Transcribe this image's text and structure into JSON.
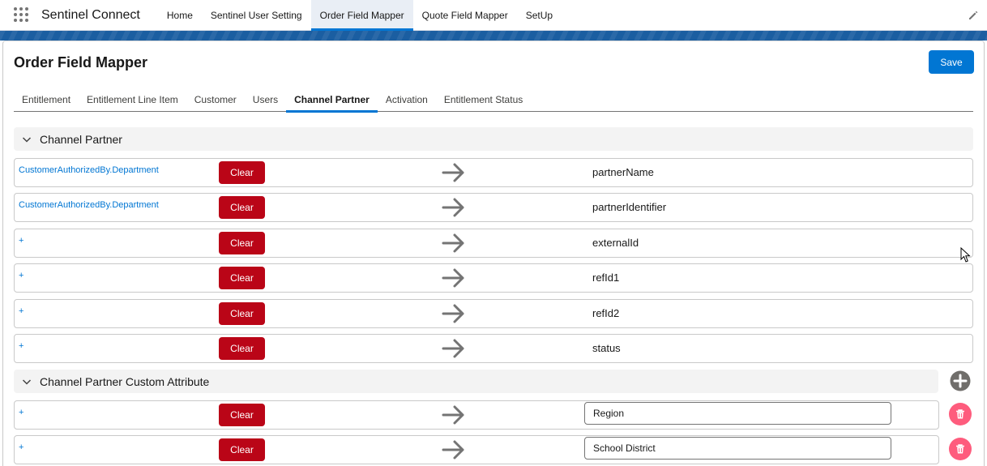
{
  "app": {
    "name": "Sentinel Connect",
    "nav": [
      {
        "label": "Home"
      },
      {
        "label": "Sentinel User Setting"
      },
      {
        "label": "Order Field Mapper",
        "active": true
      },
      {
        "label": "Quote Field Mapper"
      },
      {
        "label": "SetUp"
      }
    ]
  },
  "page": {
    "title": "Order Field Mapper",
    "save_label": "Save",
    "tabs": [
      {
        "label": "Entitlement"
      },
      {
        "label": "Entitlement Line Item"
      },
      {
        "label": "Customer"
      },
      {
        "label": "Users"
      },
      {
        "label": "Channel Partner",
        "active": true
      },
      {
        "label": "Activation"
      },
      {
        "label": "Entitlement Status"
      }
    ]
  },
  "sections": [
    {
      "label": "Channel Partner"
    },
    {
      "label": "Channel Partner Custom Attribute"
    }
  ],
  "mappings": [
    {
      "source": "CustomerAuthorizedBy.Department",
      "clear_label": "Clear",
      "target": "partnerName"
    },
    {
      "source": "CustomerAuthorizedBy.Department",
      "clear_label": "Clear",
      "target": "partnerIdentifier"
    },
    {
      "source": "+",
      "clear_label": "Clear",
      "target": "externalId"
    },
    {
      "source": "+",
      "clear_label": "Clear",
      "target": "refId1"
    },
    {
      "source": "+",
      "clear_label": "Clear",
      "target": "refId2"
    },
    {
      "source": "+",
      "clear_label": "Clear",
      "target": "status"
    }
  ],
  "custom_mappings": [
    {
      "source": "+",
      "clear_label": "Clear",
      "target_value": "Region"
    },
    {
      "source": "+",
      "clear_label": "Clear",
      "target_value": "School District"
    }
  ],
  "icons": {
    "app_launcher": "waffle-icon",
    "edit": "pencil-icon",
    "section_toggle": "chevron-down-icon",
    "mapping": "arrow-right-icon",
    "add": "add-circle-icon",
    "delete": "trash-icon"
  },
  "colors": {
    "brand": "#0176d3",
    "clear_button": "#ba0517",
    "delete_button": "#fe5c7d",
    "band": "#1b5ea1"
  }
}
